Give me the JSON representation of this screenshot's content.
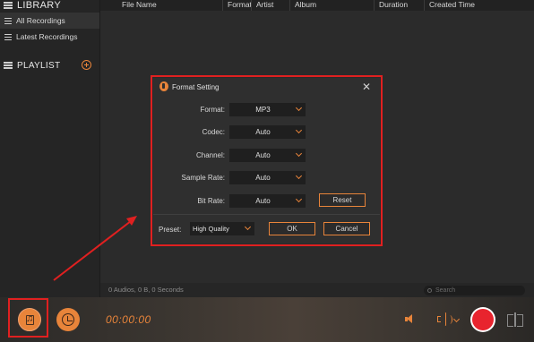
{
  "sidebar": {
    "library_title": "LIBRARY",
    "items": [
      {
        "label": "All Recordings"
      },
      {
        "label": "Latest Recordings"
      }
    ],
    "playlist_title": "PLAYLIST"
  },
  "table": {
    "columns": [
      "File Name",
      "Format",
      "Artist",
      "Album",
      "Duration",
      "Created Time"
    ]
  },
  "status": {
    "summary": "0 Audios, 0 B, 0 Seconds",
    "search_placeholder": "Search"
  },
  "player": {
    "time": "00:00:00"
  },
  "dialog": {
    "title": "Format Setting",
    "close": "✕",
    "rows": [
      {
        "label": "Format:",
        "value": "MP3"
      },
      {
        "label": "Codec:",
        "value": "Auto"
      },
      {
        "label": "Channel:",
        "value": "Auto"
      },
      {
        "label": "Sample Rate:",
        "value": "Auto"
      },
      {
        "label": "Bit Rate:",
        "value": "Auto"
      }
    ],
    "reset_label": "Reset",
    "preset_label": "Preset:",
    "preset_value": "High Quality",
    "ok_label": "OK",
    "cancel_label": "Cancel"
  },
  "colors": {
    "accent": "#e8843a",
    "highlight": "#e02020",
    "record": "#e8242e"
  }
}
